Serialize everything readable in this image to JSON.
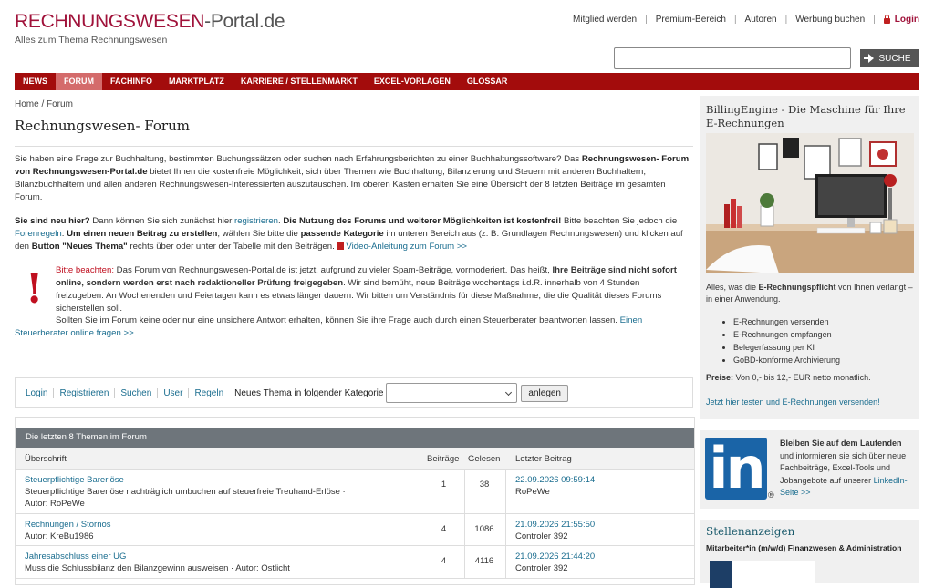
{
  "header": {
    "logo_part1": "RECHNUNGSWESEN",
    "logo_part2": "-Portal.de",
    "tagline": "Alles zum Thema Rechnungswesen",
    "top_links": [
      "Mitglied werden",
      "Premium-Bereich",
      "Autoren",
      "Werbung buchen"
    ],
    "login_label": "Login",
    "search_placeholder": "",
    "search_button": "SUCHE"
  },
  "nav": {
    "items": [
      "NEWS",
      "FORUM",
      "FACHINFO",
      "MARKTPLATZ",
      "KARRIERE / STELLENMARKT",
      "EXCEL-VORLAGEN",
      "GLOSSAR"
    ],
    "active": "FORUM"
  },
  "breadcrumb": "Home / Forum",
  "page_title": "Rechnungswesen- Forum",
  "intro": {
    "p1_a": "Sie haben eine Frage zur Buchhaltung, bestimmten Buchungssätzen oder suchen nach Erfahrungsberichten zu einer Buchhaltungssoftware? Das ",
    "p1_b": "Rechnungswesen- Forum von Rechnungswesen-Portal.de",
    "p1_c": " bietet Ihnen die kostenfreie Möglichkeit, sich über Themen wie Buchhaltung, Bilanzierung und Steuern mit anderen Buchhaltern, Bilanzbuchhaltern und allen anderen Rechnungswesen-Interessierten auszutauschen. Im oberen Kasten erhalten Sie eine Übersicht der 8 letzten Beiträge im gesamten Forum.",
    "p2_a": "Sie sind neu hier?",
    "p2_b": " Dann können Sie sich zunächst hier ",
    "p2_link1": "registrieren",
    "p2_c": ". ",
    "p2_d": "Die Nutzung des Forums und weiterer Möglichkeiten ist kostenfrei!",
    "p2_e": " Bitte beachten Sie jedoch die ",
    "p2_link2": "Forenregeln",
    "p2_f": ". ",
    "p2_g": "Um einen neuen Beitrag zu erstellen",
    "p2_h": ", wählen Sie bitte die ",
    "p2_i": "passende Kategorie",
    "p2_j": " im unteren Bereich aus (z. B. Grundlagen Rechnungswesen) und klicken auf den ",
    "p2_k": "Button \"Neues Thema\"",
    "p2_l": " rechts über oder unter der Tabelle mit den Beiträgen. ",
    "p2_link3": "Video-Anleitung zum Forum >>"
  },
  "notice": {
    "label": "Bitte beachten:",
    "t1": " Das Forum von Rechnungswesen-Portal.de ist jetzt, aufgrund zu vieler Spam-Beiträge, vormoderiert. Das heißt, ",
    "t2": "Ihre Beiträge sind nicht sofort online, sondern werden erst nach redaktioneller Prüfung freigegeben",
    "t3": ". Wir sind bemüht, neue Beiträge wochentags i.d.R. innerhalb von 4 Stunden freizugeben. An Wochenenden und Feiertagen kann es etwas länger dauern. Wir bitten um Verständnis für diese Maßnahme, die die Qualität dieses Forums sicherstellen soll.",
    "advisor_text": "Sollten Sie im Forum keine oder nur eine unsichere Antwort erhalten, können Sie ihre Frage auch durch einen Steuerberater beantworten lassen.  ",
    "advisor_link": "Einen Steuerberater online fragen  >>"
  },
  "toolbar": {
    "links": [
      "Login",
      "Registrieren",
      "Suchen",
      "User",
      "Regeln"
    ],
    "category_label": "Neues Thema in folgender Kategorie",
    "category_value": "",
    "add_button": "anlegen"
  },
  "topics": {
    "heading": "Die letzten 8 Themen im Forum",
    "columns": [
      "Überschrift",
      "Beiträge",
      "Gelesen",
      "Letzter Beitrag"
    ],
    "rows": [
      {
        "title": "Steuerpflichtige Barerlöse",
        "desc": "Steuerpflichtige Barerlöse nachträglich umbuchen auf steuerfreie Treuhand-Erlöse  ·",
        "author": "Autor: RoPeWe",
        "posts": "1",
        "reads": "38",
        "date": "22.09.2026 09:59:14",
        "last_user": "RoPeWe"
      },
      {
        "title": "Rechnungen / Stornos",
        "desc": "",
        "author": "Autor: KreBu1986",
        "posts": "4",
        "reads": "1086",
        "date": "21.09.2026 21:55:50",
        "last_user": "Controler 392"
      },
      {
        "title": "Jahresabschluss einer UG",
        "desc": "Muss die Schlussbilanz den Bilanzgewinn ausweisen · Autor: Ostlicht",
        "author": "",
        "posts": "4",
        "reads": "4116",
        "date": "21.09.2026 21:44:20",
        "last_user": "Controler 392"
      }
    ]
  },
  "sidebar": {
    "billing": {
      "title": "BillingEngine - Die Maschine für Ihre E-Rechnungen",
      "text_a": "Alles, was die ",
      "text_b": "E-Rechnungspflicht",
      "text_c": " von Ihnen verlangt – in einer Anwendung.",
      "features": [
        "E-Rechnungen versenden",
        "E-Rechnungen empfangen",
        "Belegerfassung per KI",
        "GoBD-konforme Archivierung"
      ],
      "price_label": "Preise:",
      "price_text": " Von 0,- bis 12,- EUR netto monatlich.",
      "cta": "Jetzt hier testen und E-Rechnungen versenden!"
    },
    "linkedin": {
      "logo": "in",
      "reg": "®",
      "text_bold": "Bleiben Sie auf dem Laufenden",
      "text": " und informieren sie sich über neue Fachbeiträge, Excel-Tools und Jobangebote auf unserer ",
      "link": "LinkedIn-Seite >>"
    },
    "jobs": {
      "title": "Stellenanzeigen",
      "first_job": "Mitarbeiter*in (m/w/d) Finanzwesen & Administration"
    }
  }
}
